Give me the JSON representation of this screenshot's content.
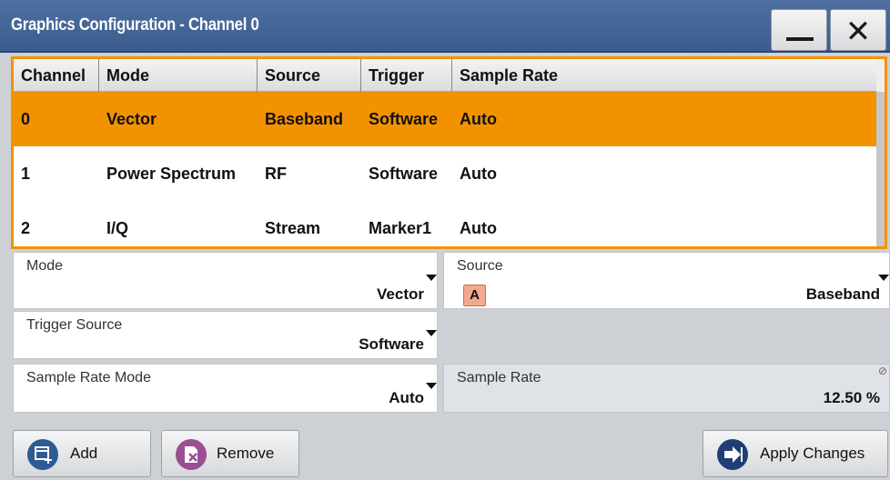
{
  "window": {
    "title": "Graphics Configuration - Channel 0"
  },
  "table": {
    "columns": [
      "Channel",
      "Mode",
      "Source",
      "Trigger",
      "Sample Rate"
    ],
    "rows": [
      {
        "channel": "0",
        "mode": "Vector",
        "source": "Baseband",
        "trigger": "Software",
        "sample_rate": "Auto",
        "selected": true
      },
      {
        "channel": "1",
        "mode": "Power Spectrum",
        "source": "RF",
        "trigger": "Software",
        "sample_rate": "Auto",
        "selected": false
      },
      {
        "channel": "2",
        "mode": "I/Q",
        "source": "Stream",
        "trigger": "Marker1",
        "sample_rate": "Auto",
        "selected": false
      }
    ],
    "highlight_color": "#f39200"
  },
  "form": {
    "mode": {
      "label": "Mode",
      "value": "Vector"
    },
    "source": {
      "label": "Source",
      "value": "Baseband",
      "badge": "A"
    },
    "trigger_source": {
      "label": "Trigger Source",
      "value": "Software"
    },
    "sample_rate_mode": {
      "label": "Sample Rate Mode",
      "value": "Auto"
    },
    "sample_rate": {
      "label": "Sample Rate",
      "value": "12.50 %"
    }
  },
  "buttons": {
    "add": {
      "label": "Add",
      "icon": "add-window-icon"
    },
    "remove": {
      "label": "Remove",
      "icon": "remove-icon"
    },
    "apply": {
      "label": "Apply Changes",
      "icon": "arrow-right-icon"
    }
  }
}
